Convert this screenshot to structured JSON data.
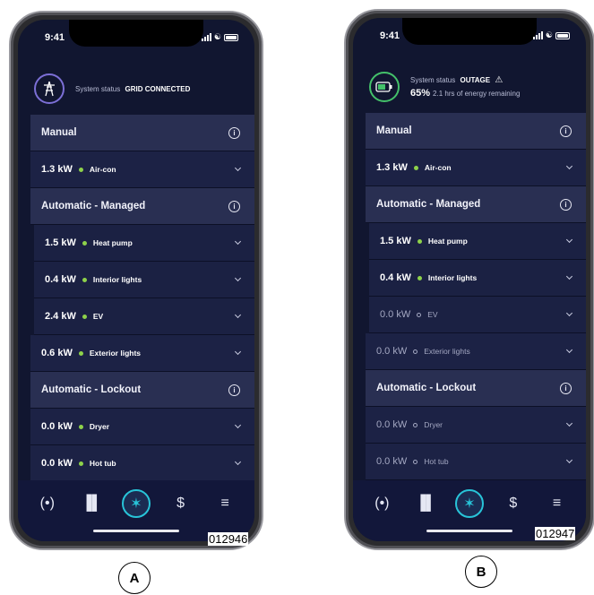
{
  "phones": [
    {
      "time": "9:41",
      "status": {
        "label": "System status",
        "value": "GRID CONNECTED",
        "percent": "",
        "remaining": ""
      },
      "rows": [
        {
          "type": "head",
          "text": "Manual"
        },
        {
          "type": "item",
          "kw": "1.3 kW",
          "label": "Air-con",
          "active": true
        },
        {
          "type": "head",
          "text": "Automatic - Managed"
        },
        {
          "type": "item",
          "kw": "1.5 kW",
          "label": "Heat pump",
          "active": true
        },
        {
          "type": "item",
          "kw": "0.4 kW",
          "label": "Interior lights",
          "active": true
        },
        {
          "type": "item",
          "kw": "2.4 kW",
          "label": "EV",
          "active": true
        },
        {
          "type": "item",
          "kw": "0.6 kW",
          "label": "Exterior lights",
          "active": true
        },
        {
          "type": "head",
          "text": "Automatic - Lockout"
        },
        {
          "type": "item",
          "kw": "0.0 kW",
          "label": "Dryer",
          "active": true
        },
        {
          "type": "item",
          "kw": "0.0 kW",
          "label": "Hot tub",
          "active": true
        }
      ],
      "figure_code": "012946",
      "caption": "A"
    },
    {
      "time": "9:41",
      "status": {
        "label": "System status",
        "value": "OUTAGE",
        "percent": "65%",
        "remaining": "2.1 hrs of energy remaining"
      },
      "rows": [
        {
          "type": "head",
          "text": "Manual"
        },
        {
          "type": "item",
          "kw": "1.3 kW",
          "label": "Air-con",
          "active": true
        },
        {
          "type": "head",
          "text": "Automatic - Managed"
        },
        {
          "type": "item",
          "kw": "1.5 kW",
          "label": "Heat pump",
          "active": true
        },
        {
          "type": "item",
          "kw": "0.4 kW",
          "label": "Interior lights",
          "active": true
        },
        {
          "type": "item",
          "kw": "0.0 kW",
          "label": "EV",
          "active": false
        },
        {
          "type": "item",
          "kw": "0.0 kW",
          "label": "Exterior lights",
          "active": false
        },
        {
          "type": "head",
          "text": "Automatic - Lockout"
        },
        {
          "type": "item",
          "kw": "0.0 kW",
          "label": "Dryer",
          "active": false
        },
        {
          "type": "item",
          "kw": "0.0 kW",
          "label": "Hot tub",
          "active": false
        }
      ],
      "figure_code": "012947",
      "caption": "B"
    }
  ],
  "nav": [
    "radio-status-icon",
    "bar-chart-icon",
    "home-hub-icon",
    "dollar-icon",
    "sliders-icon"
  ],
  "colors": {
    "accent": "#28c4d8",
    "active_dot": "#8ed24a",
    "background": "#111630",
    "battery": "#44c16a"
  }
}
